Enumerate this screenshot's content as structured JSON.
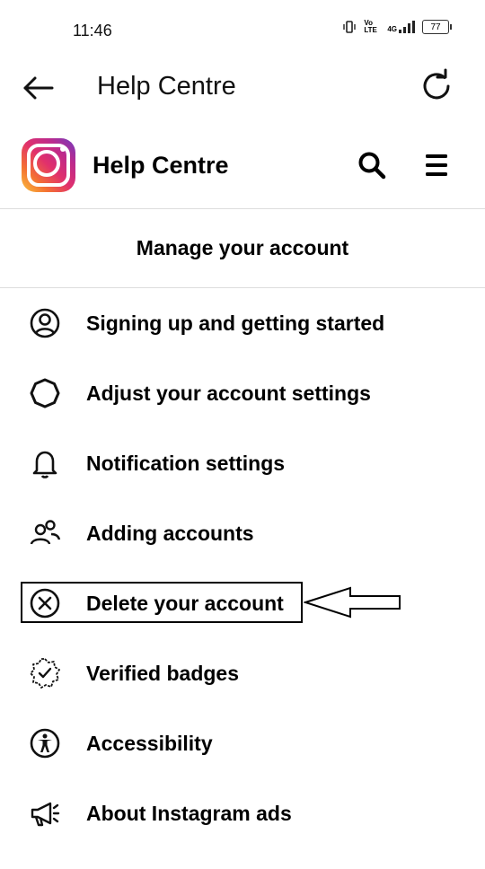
{
  "status_bar": {
    "time": "11:46",
    "network": "4G",
    "volte": "Vo LTE",
    "battery": "77"
  },
  "app_bar": {
    "title": "Help Centre",
    "back_icon": "arrow-left-icon",
    "reload_icon": "reload-icon"
  },
  "site_header": {
    "logo": "instagram-logo",
    "title": "Help Centre",
    "search_icon": "search-icon",
    "menu_icon": "hamburger-menu-icon"
  },
  "section": {
    "title": "Manage your account"
  },
  "menu_items": [
    {
      "label": "Signing up and getting started",
      "icon": "user-circle-icon"
    },
    {
      "label": "Adjust your account settings",
      "icon": "gear-icon"
    },
    {
      "label": "Notification settings",
      "icon": "bell-icon"
    },
    {
      "label": "Adding accounts",
      "icon": "users-icon"
    },
    {
      "label": "Delete your account",
      "icon": "x-circle-icon"
    },
    {
      "label": "Verified badges",
      "icon": "verified-badge-icon"
    },
    {
      "label": "Accessibility",
      "icon": "accessibility-icon"
    },
    {
      "label": "About Instagram ads",
      "icon": "megaphone-icon"
    }
  ],
  "annotation": {
    "highlighted_item": "Delete your account",
    "arrow": "arrow-pointing-left"
  },
  "colors": {
    "background": "#ffffff",
    "text": "#000000",
    "divider": "#dcdcdc"
  }
}
